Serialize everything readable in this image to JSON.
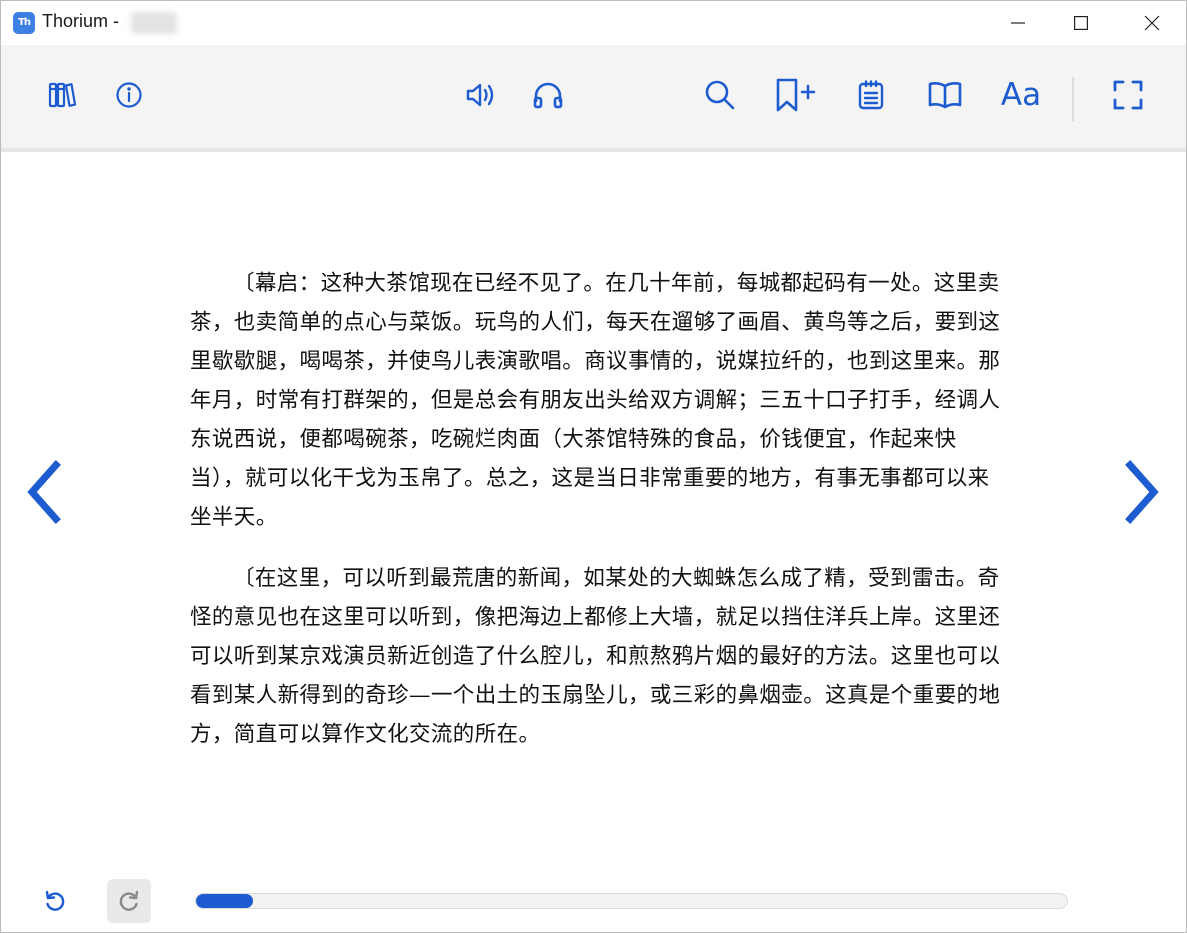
{
  "window": {
    "app_title": "Thorium - ",
    "logo_text": "Th"
  },
  "toolbar": {
    "left": [
      "library-icon",
      "info-icon"
    ],
    "center": [
      "read-aloud-icon",
      "audio-headphones-icon"
    ],
    "right": [
      "search-icon",
      "add-bookmark-icon",
      "notes-icon",
      "table-of-contents-icon",
      "text-settings-icon",
      "fullscreen-icon"
    ],
    "text_settings_label": "Aa"
  },
  "content": {
    "paragraphs": [
      "〔幕启：这种大茶馆现在已经不见了。在几十年前，每城都起码有一处。这里卖茶，也卖简单的点心与菜饭。玩鸟的人们，每天在遛够了画眉、黄鸟等之后，要到这里歇歇腿，喝喝茶，并使鸟儿表演歌唱。商议事情的，说媒拉纤的，也到这里来。那年月，时常有打群架的，但是总会有朋友出头给双方调解；三五十口子打手，经调人东说西说，便都喝碗茶，吃碗烂肉面（大茶馆特殊的食品，价钱便宜，作起来快当），就可以化干戈为玉帛了。总之，这是当日非常重要的地方，有事无事都可以来坐半天。",
      "〔在这里，可以听到最荒唐的新闻，如某处的大蜘蛛怎么成了精，受到雷击。奇怪的意见也在这里可以听到，像把海边上都修上大墙，就足以挡住洋兵上岸。这里还可以听到某京戏演员新近创造了什么腔儿，和煎熬鸦片烟的最好的方法。这里也可以看到某人新得到的奇珍—一个出土的玉扇坠儿，或三彩的鼻烟壶。这真是个重要的地方，简直可以算作文化交流的所在。"
    ]
  },
  "navigation": {
    "prev": "chevron-left-icon",
    "next": "chevron-right-icon"
  },
  "bottom": {
    "back": "history-back-icon",
    "forward": "history-forward-icon",
    "progress_percent": 6.5
  },
  "colors": {
    "accent": "#1d5bd1",
    "toolbar_bg": "#f4f4f4",
    "text": "#111111"
  }
}
